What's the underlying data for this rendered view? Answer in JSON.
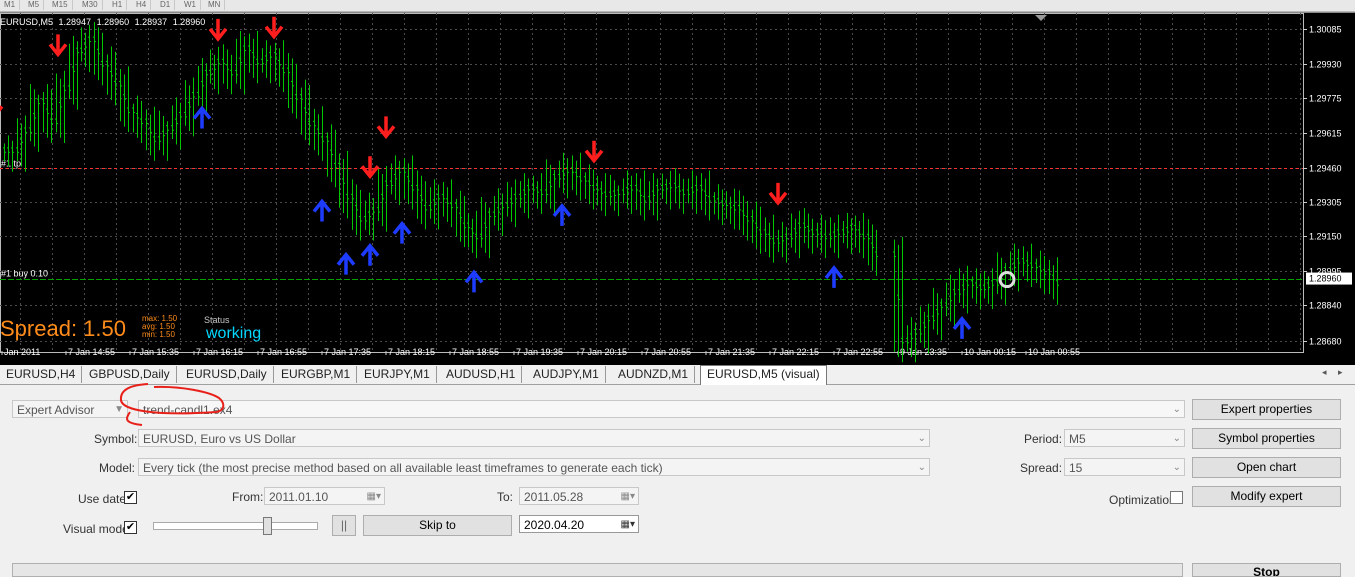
{
  "toolbar": {
    "items": [
      "M1",
      "M5",
      "M15",
      "M30",
      "H1",
      "H4",
      "D1",
      "W1",
      "MN"
    ]
  },
  "chart": {
    "header": {
      "symbol": "EURUSD,M5",
      "o": "1.28947",
      "h": "1.28960",
      "l": "1.28937",
      "c": "1.28960"
    },
    "trade_tp_label": "#1 tp",
    "trade_buy_label": "#1 buy 0.10",
    "spread_text": "Spread: 1.50",
    "spread_stats": [
      "max: 1.50",
      "avg: 1.50",
      "min: 1.50"
    ],
    "status_label": "Status",
    "status_value": "working",
    "current_price": "1.28960",
    "colors": {
      "background": "#000000",
      "candle": "#00c800",
      "sell_arrow": "#ff1e1e",
      "buy_arrow": "#1e3cff",
      "grid": "#4a4a4a",
      "tp_line": "#ff3030",
      "buy_line": "#00a000"
    }
  },
  "chart_data": {
    "type": "candlestick",
    "price_ticks": [
      "1.30085",
      "1.29930",
      "1.29775",
      "1.29615",
      "1.29460",
      "1.29305",
      "1.29150",
      "1.28995",
      "1.28840",
      "1.28680"
    ],
    "time_labels": [
      "Jan 2011",
      "7 Jan 14:55",
      "7 Jan 15:35",
      "7 Jan 16:15",
      "7 Jan 16:55",
      "7 Jan 17:35",
      "7 Jan 18:15",
      "7 Jan 18:55",
      "7 Jan 19:35",
      "7 Jan 20:15",
      "7 Jan 20:55",
      "7 Jan 21:35",
      "7 Jan 22:15",
      "7 Jan 22:55",
      "9 Jan 23:35",
      "10 Jan 00:15",
      "10 Jan 00:55"
    ],
    "ylim": [
      1.2866,
      1.3015
    ],
    "tp_level": 1.2946,
    "buy_level": 1.2896,
    "closes": [
      1.2953,
      1.2962,
      1.2975,
      1.2966,
      1.2981,
      1.2998,
      1.3003,
      1.2992,
      1.2983,
      1.2971,
      1.2966,
      1.2958,
      1.2963,
      1.2969,
      1.2978,
      1.2988,
      1.2993,
      1.2988,
      1.2999,
      1.2993,
      1.2996,
      1.2989,
      1.2977,
      1.2965,
      1.2958,
      1.2946,
      1.2932,
      1.2922,
      1.2926,
      1.2938,
      1.2944,
      1.2936,
      1.2927,
      1.2932,
      1.2928,
      1.2919,
      1.2914,
      1.2924,
      1.2928,
      1.2932,
      1.2936,
      1.2934,
      1.2941,
      1.2944,
      1.294,
      1.2936,
      1.2933,
      1.2934,
      1.2936,
      1.2931,
      1.2936,
      1.2937,
      1.2934,
      1.2936,
      1.2931,
      1.2929,
      1.2927,
      1.2922,
      1.2916,
      1.2912,
      1.2914,
      1.2919,
      1.2916,
      1.2914,
      1.2916,
      1.2918,
      1.2914,
      1.2906,
      null,
      1.2867,
      1.2871,
      1.2877,
      1.2883,
      1.2889,
      1.2893,
      1.2891,
      1.2893,
      1.2899,
      1.2903,
      1.2901,
      1.2898,
      1.2893
    ],
    "sell_signals": [
      "7 Jan 14:10",
      "7 Jan 14:50",
      "7 Jan 16:30",
      "7 Jan 17:05",
      "7 Jan 18:05",
      "7 Jan 18:15",
      "7 Jan 20:25",
      "7 Jan 22:20"
    ],
    "buy_signals": [
      "7 Jan 14:05",
      "7 Jan 16:20",
      "7 Jan 17:35",
      "7 Jan 17:50",
      "7 Jan 18:05",
      "7 Jan 18:25",
      "7 Jan 19:10",
      "7 Jan 20:05",
      "7 Jan 22:55",
      "10 Jan 00:15"
    ]
  },
  "tabs": {
    "items": [
      "EURUSD,H4",
      "GBPUSD,Daily",
      "EURUSD,Daily",
      "EURGBP,M1",
      "EURJPY,M1",
      "AUDUSD,H1",
      "AUDJPY,M1",
      "AUDNZD,M1",
      "EURUSD,M5 (visual)"
    ],
    "active_index": 8,
    "scroll_left": "◂",
    "scroll_right": "▸"
  },
  "tester": {
    "type_select": "Expert Advisor",
    "expert_file": "trend-candl1.ex4",
    "symbol_label": "Symbol:",
    "symbol_value": "EURUSD, Euro vs US Dollar",
    "model_label": "Model:",
    "model_value": "Every tick (the most precise method based on all available least timeframes to generate each tick)",
    "use_date_label": "Use date",
    "use_date_checked": "✔",
    "from_label": "From:",
    "from_value": "2011.01.10",
    "to_label": "To:",
    "to_value": "2011.05.28",
    "visual_mode_label": "Visual mode",
    "visual_mode_checked": "✔",
    "speed": 0.7,
    "pause_label": "||",
    "skip_to_label": "Skip to",
    "skip_to_date": "2020.04.20",
    "period_label": "Period:",
    "period_value": "M5",
    "spread_label": "Spread:",
    "spread_value": "15",
    "optimization_label": "Optimization",
    "buttons": {
      "expert_properties": "Expert properties",
      "symbol_properties": "Symbol properties",
      "open_chart": "Open chart",
      "modify_expert": "Modify expert",
      "stop": "Stop"
    },
    "annotation_color": "#e8201a"
  }
}
